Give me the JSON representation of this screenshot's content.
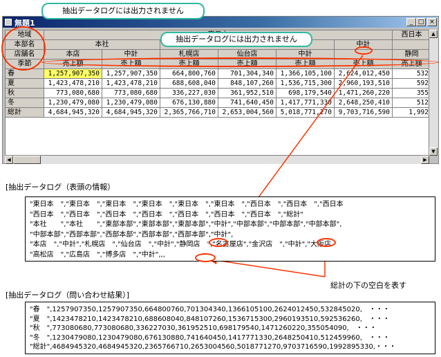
{
  "window": {
    "title": "無題1"
  },
  "callouts": {
    "top": "抽出データログには出力されません",
    "middle": "抽出データログには出力されません"
  },
  "row_headers": {
    "region": "地域",
    "division": "本部名",
    "store": "店舗名",
    "season": "季節"
  },
  "header": {
    "row1": [
      "東日本",
      "",
      "",
      "",
      "",
      "",
      "",
      "西日本"
    ],
    "row2": [
      "本社",
      "中計",
      "",
      "東部本部",
      "",
      "",
      "中計",
      ""
    ],
    "row3": [
      "本店",
      "中計",
      "札幌店",
      "仙台店",
      "中計",
      "",
      "静岡"
    ],
    "row4_label": "売上額",
    "col_count": 8
  },
  "table": {
    "rows": [
      {
        "label": "春",
        "values": [
          "1,257,907,350",
          "1,257,907,350",
          "664,800,760",
          "701,304,340",
          "1,366,105,100",
          "2,624,012,450",
          "532"
        ]
      },
      {
        "label": "夏",
        "values": [
          "1,423,478,210",
          "1,423,478,210",
          "688,608,040",
          "848,107,260",
          "1,536,715,300",
          "2,960,193,510",
          "592"
        ]
      },
      {
        "label": "秋",
        "values": [
          "773,080,680",
          "773,080,680",
          "336,227,030",
          "361,952,510",
          "698,179,540",
          "1,471,260,220",
          "355"
        ]
      },
      {
        "label": "冬",
        "values": [
          "1,230,479,080",
          "1,230,479,080",
          "676,130,880",
          "741,640,450",
          "1,417,771,330",
          "2,648,250,410",
          "512"
        ]
      },
      {
        "label": "総計",
        "values": [
          "4,684,945,320",
          "4,684,945,320",
          "2,365,766,710",
          "2,653,004,560",
          "5,018,771,270",
          "9,703,716,590",
          "1,992"
        ]
      }
    ]
  },
  "header_log": {
    "title": "[抽出データログ（表頭の情報）",
    "lines": [
      "\"東日本　\",\"東日本　\",\"東日本　\",\"東日本　\",\"東日本　\",\"東日本　\",\"西日本　\",\"西日本　\",\"西日本",
      "\"西日本　\",\"西日本　\",\"西日本　\",\"西日本　\",\"西日本　\",\"西日本　\",\"西日本　\",\"総計\"",
      "\"本社　　\",\"本社　　\",\"東部本部\",\"東部本部\",\"東部本部\",\"中計\",\"中部本部\",\"中部本部\",\"中部本部\",",
      "\"中部本部\",\"西部本部\",\"西部本部\",\"西部本部\",\"西部本部\",\"中計\",",
      "\"本店　\",\"中計\",\"札幌店　\",\"仙台店　\",\"中計\",\"静岡店　\",\"名古屋店\",\"金沢店　\",\"中計\",\"大阪店",
      "\"高松店　\",\"広島店　\",\"博多店　\",\"中計\",,,"
    ]
  },
  "annotation": "総計の下の空白を表す",
  "result_log": {
    "title": "[抽出データログ（問い合わせ結果）]",
    "lines": [
      "\"春　\",1257907350,1257907350,664800760,701304340,1366105100,2624012450,532845020,　・・・",
      "\"夏　\",1423478210,1423478210,688608040,848107260,1536715300,2960193510,592536260,　・・・",
      "\"秋　\",773080680,773080680,336227030,361952510,698179540,1471260220,355054090,　・・・",
      "\"冬　\",1230479080,1230479080,676130880,741640450,1417771330,2648250410,512459960,　・・・",
      "\"総計\",4684945320,4684945320,2365766710,2653004560,5018771270,9703716590,1992895330,・・・"
    ]
  },
  "colors": {
    "callout_border": "#2fb9a0",
    "highlight": "#ffff66",
    "ellipse": "#ff3300",
    "titlebar": "#0a246a"
  }
}
